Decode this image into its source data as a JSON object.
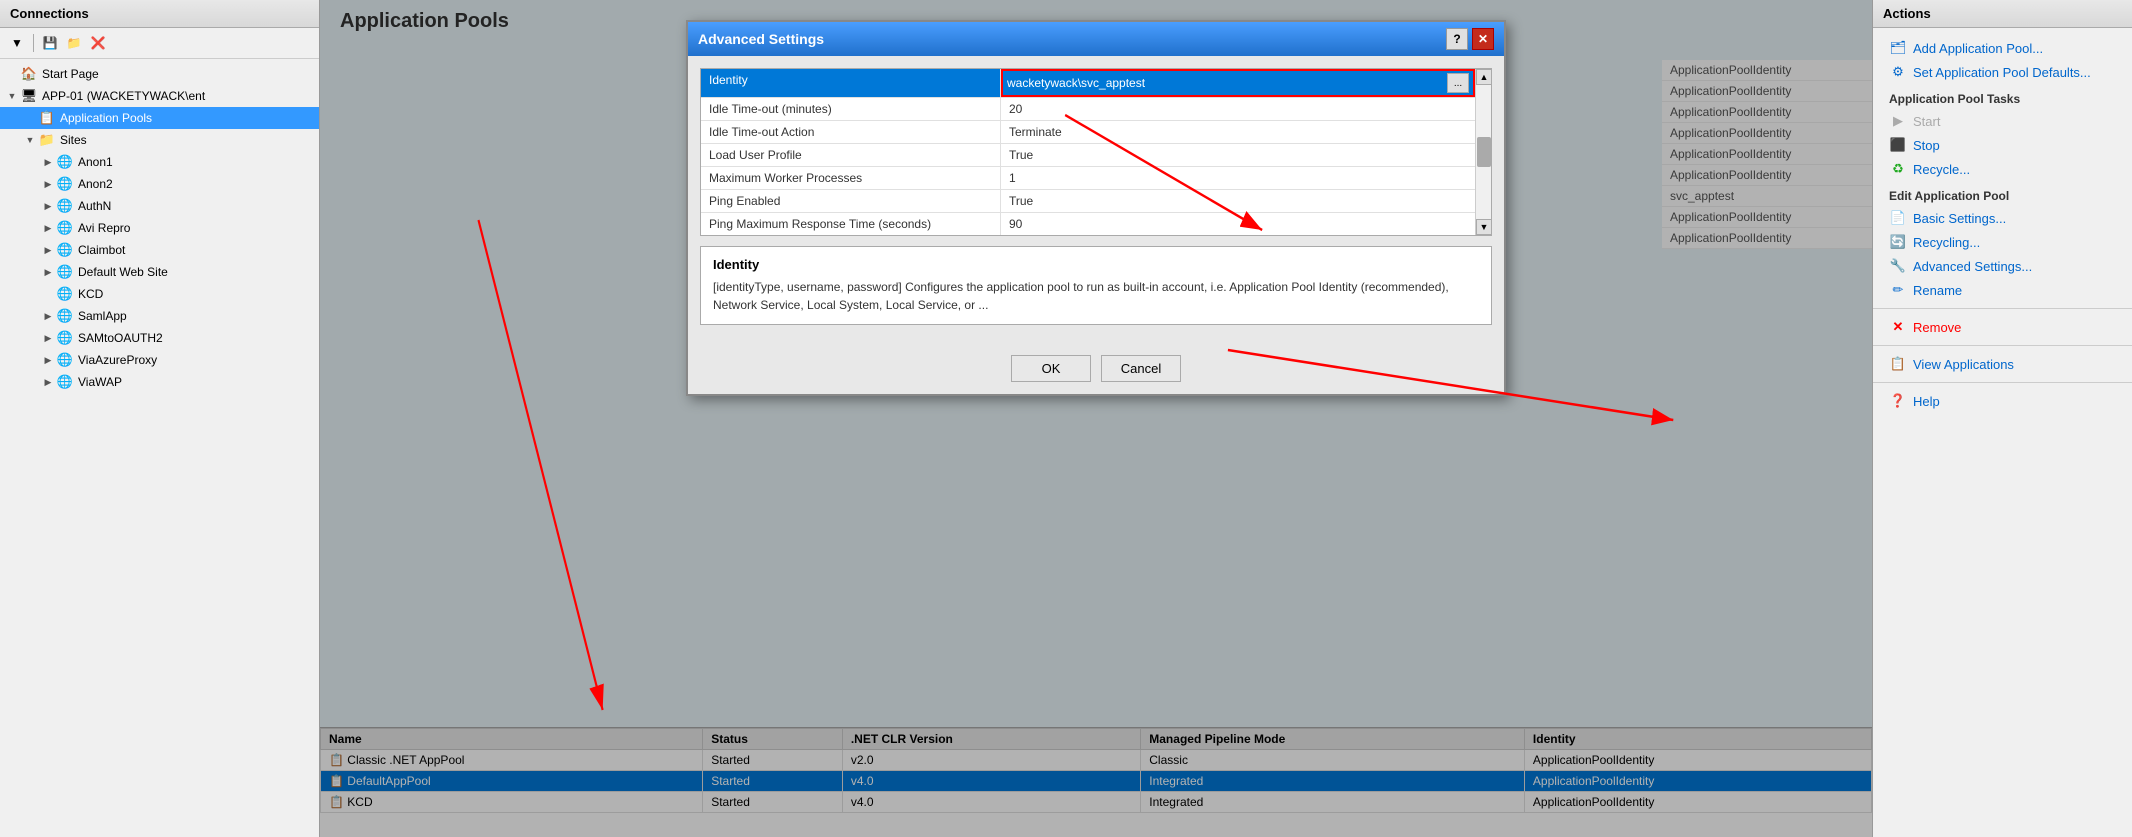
{
  "connections": {
    "header": "Connections",
    "toolbar_icons": [
      "dropdown-icon",
      "save-icon",
      "folder-icon",
      "delete-icon"
    ],
    "tree": [
      {
        "id": "start-page",
        "label": "Start Page",
        "level": 0,
        "icon": "🏠",
        "toggle": null
      },
      {
        "id": "app01",
        "label": "APP-01 (WACKETYWACK\\ent",
        "level": 0,
        "icon": "🖥",
        "toggle": "▼"
      },
      {
        "id": "app-pools",
        "label": "Application Pools",
        "level": 1,
        "icon": "📋",
        "toggle": null,
        "selected": true
      },
      {
        "id": "sites",
        "label": "Sites",
        "level": 1,
        "icon": "📁",
        "toggle": "▼"
      },
      {
        "id": "anon1",
        "label": "Anon1",
        "level": 2,
        "icon": "🌐",
        "toggle": "▶"
      },
      {
        "id": "anon2",
        "label": "Anon2",
        "level": 2,
        "icon": "🌐",
        "toggle": "▶"
      },
      {
        "id": "authn",
        "label": "AuthN",
        "level": 2,
        "icon": "🌐",
        "toggle": "▶"
      },
      {
        "id": "avi-repro",
        "label": "Avi Repro",
        "level": 2,
        "icon": "🌐",
        "toggle": "▶"
      },
      {
        "id": "claimbot",
        "label": "Claimbot",
        "level": 2,
        "icon": "🌐",
        "toggle": "▶"
      },
      {
        "id": "default-web-site",
        "label": "Default Web Site",
        "level": 2,
        "icon": "🌐",
        "toggle": "▶"
      },
      {
        "id": "kcd",
        "label": "KCD",
        "level": 2,
        "icon": "🌐",
        "toggle": null
      },
      {
        "id": "samlapp",
        "label": "SamlApp",
        "level": 2,
        "icon": "🌐",
        "toggle": "▶"
      },
      {
        "id": "samtoauth2",
        "label": "SAMtoOAUTH2",
        "level": 2,
        "icon": "🌐",
        "toggle": "▶"
      },
      {
        "id": "viaazureproxy",
        "label": "ViaAzureProxy",
        "level": 2,
        "icon": "🌐",
        "toggle": "▶"
      },
      {
        "id": "viawap",
        "label": "ViaWAP",
        "level": 2,
        "icon": "🌐",
        "toggle": "▶"
      }
    ]
  },
  "app_pools_title": "Application Pools",
  "app_pools_table": {
    "columns": [
      "Name",
      "Status",
      ".NET CLR Version",
      "Managed Pipeline Mode",
      "Identity"
    ],
    "rows": [
      {
        "name": "Classic .NET AppPool",
        "status": "Started",
        "clr": "v2.0",
        "pipeline": "Classic",
        "identity": "ApplicationPoolIdentity",
        "selected": false
      },
      {
        "name": "DefaultAppPool",
        "status": "Started",
        "clr": "v4.0",
        "pipeline": "Integrated",
        "identity": "ApplicationPoolIdentity",
        "selected": true
      },
      {
        "name": "KCD",
        "status": "Started",
        "clr": "v4.0",
        "pipeline": "Integrated",
        "identity": "ApplicationPoolIdentity",
        "selected": false
      }
    ]
  },
  "bg_identity_items": [
    "ApplicationPoolIdentity",
    "ApplicationPoolIdentity",
    "ApplicationPoolIdentity",
    "ApplicationPoolIdentity",
    "ApplicationPoolIdentity",
    "ApplicationPoolIdentity",
    "svc_apptest",
    "ApplicationPoolIdentity",
    "ApplicationPoolIdentity"
  ],
  "dialog": {
    "title": "Advanced Settings",
    "help_btn": "?",
    "close_btn": "✕",
    "settings": [
      {
        "key": "Identity",
        "value": "wacketywack\\svc_apptest",
        "highlight": true
      },
      {
        "key": "Idle Time-out (minutes)",
        "value": "20"
      },
      {
        "key": "Idle Time-out Action",
        "value": "Terminate"
      },
      {
        "key": "Load User Profile",
        "value": "True"
      },
      {
        "key": "Maximum Worker Processes",
        "value": "1"
      },
      {
        "key": "Ping Enabled",
        "value": "True"
      },
      {
        "key": "Ping Maximum Response Time (seconds)",
        "value": "90"
      }
    ],
    "identity_section": {
      "title": "Identity",
      "text": "[identityType, username, password] Configures the application pool to run as built-in account, i.e. Application Pool Identity (recommended), Network Service, Local System, Local Service, or ..."
    },
    "ok_label": "OK",
    "cancel_label": "Cancel"
  },
  "actions": {
    "header": "Actions",
    "items": [
      {
        "type": "link",
        "label": "Add Application Pool...",
        "icon": "➕",
        "section": null
      },
      {
        "type": "link",
        "label": "Set Application Pool Defaults...",
        "icon": "⚙",
        "section": null
      },
      {
        "type": "section",
        "label": "Application Pool Tasks"
      },
      {
        "type": "link",
        "label": "Start",
        "icon": "▶",
        "disabled": true
      },
      {
        "type": "link",
        "label": "Stop",
        "icon": "⬛"
      },
      {
        "type": "link",
        "label": "Recycle...",
        "icon": "♻"
      },
      {
        "type": "section",
        "label": "Edit Application Pool"
      },
      {
        "type": "link",
        "label": "Basic Settings...",
        "icon": "📄"
      },
      {
        "type": "link",
        "label": "Recycling...",
        "icon": "🔄"
      },
      {
        "type": "link",
        "label": "Advanced Settings...",
        "icon": "🔧"
      },
      {
        "type": "link",
        "label": "Rename",
        "icon": "✏"
      },
      {
        "type": "divider"
      },
      {
        "type": "link",
        "label": "Remove",
        "icon": "✕",
        "red": true
      },
      {
        "type": "divider"
      },
      {
        "type": "link",
        "label": "View Applications",
        "icon": "📋"
      },
      {
        "type": "divider"
      },
      {
        "type": "link",
        "label": "Help",
        "icon": "❓"
      }
    ]
  }
}
